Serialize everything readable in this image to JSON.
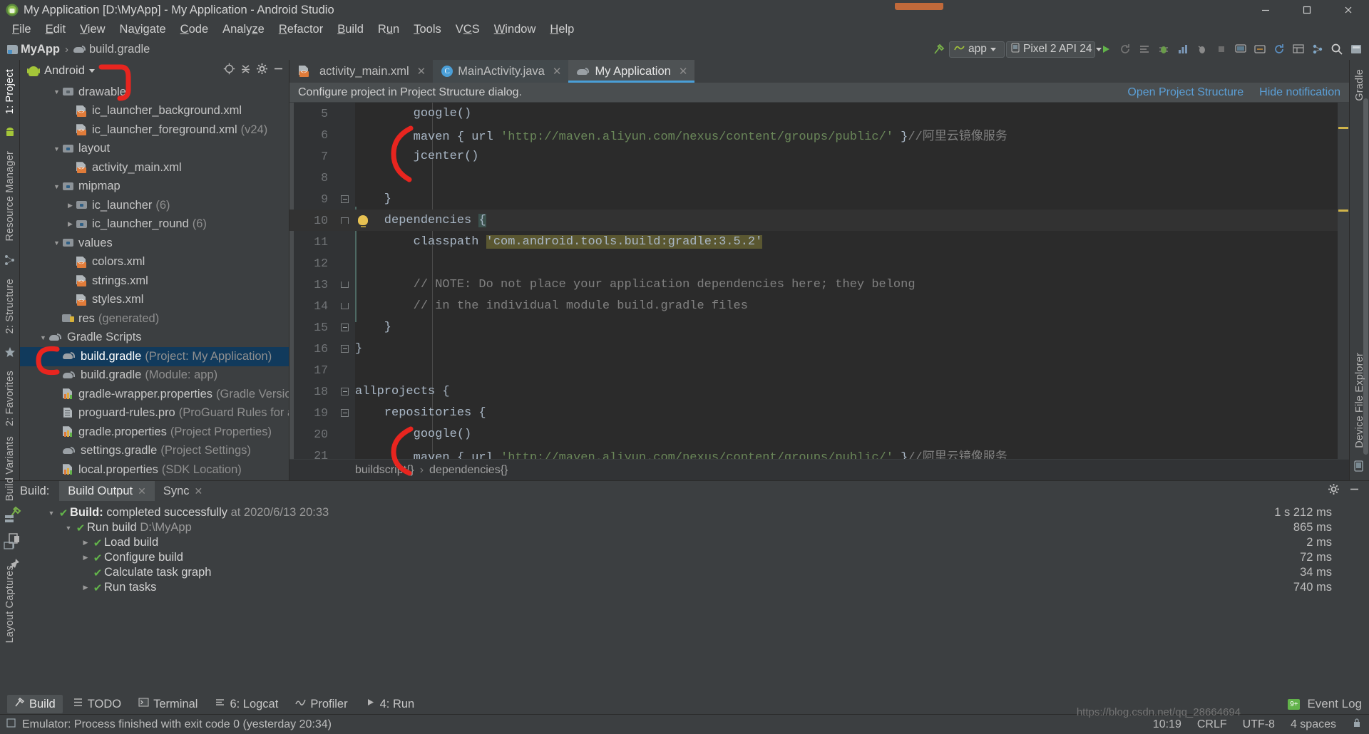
{
  "window": {
    "title": "My Application [D:\\MyApp] - My Application - Android Studio",
    "app_icon": "android-studio-icon",
    "minimize": "–",
    "maximize": "▢",
    "close": "✕"
  },
  "menubar": {
    "items": [
      {
        "label": "File"
      },
      {
        "label": "Edit"
      },
      {
        "label": "View"
      },
      {
        "label": "Navigate"
      },
      {
        "label": "Code"
      },
      {
        "label": "Analyze"
      },
      {
        "label": "Refactor"
      },
      {
        "label": "Build"
      },
      {
        "label": "Run"
      },
      {
        "label": "Tools"
      },
      {
        "label": "VCS"
      },
      {
        "label": "Window"
      },
      {
        "label": "Help"
      }
    ]
  },
  "toolbar": {
    "breadcrumb": {
      "project": "MyApp",
      "separator": "›",
      "file": "build.gradle"
    },
    "module_selector": "app",
    "device_selector": "Pixel 2 API 24",
    "run_icon": "run-play-icon",
    "rerun_icon": "rerun-icon",
    "apply_changes_icon": "apply-changes-icon",
    "debug_icon": "debug-icon",
    "profile_icon": "profile-icon",
    "attach_icon": "attach-debugger-icon",
    "stop_icon": "stop-icon",
    "avd_icon": "avd-manager-icon",
    "sdk_icon": "sdk-manager-icon",
    "sync_icon": "gradle-sync-icon",
    "search_icon": "search-everywhere-icon",
    "layout_icon": "layout-inspector-icon",
    "hammer_icon": "make-project-icon",
    "project_structure_icon": "project-structure-icon"
  },
  "left_rail": {
    "tabs": [
      {
        "label": "1: Project",
        "active": true
      },
      {
        "label": "Resource Manager",
        "active": false
      },
      {
        "label": "2: Structure",
        "active": false
      },
      {
        "label": "2: Favorites",
        "active": false
      }
    ]
  },
  "right_rail": {
    "tabs": [
      {
        "label": "Gradle"
      },
      {
        "label": "Device File Explorer"
      }
    ]
  },
  "bottom_left_rail": {
    "tabs": [
      {
        "label": "Build Variants"
      },
      {
        "label": "Layout Captures"
      }
    ]
  },
  "project_panel": {
    "title": "Android",
    "dropdown_caret": "▾",
    "locate_icon": "locate-file-icon",
    "collapse_icon": "collapse-all-icon",
    "settings_icon": "gear-icon",
    "hide_icon": "hide-panel-icon",
    "tree": [
      {
        "indent": 2,
        "arrow": "▼",
        "icon": "folder-drawable",
        "label": "drawable",
        "sub": ""
      },
      {
        "indent": 3,
        "arrow": "",
        "icon": "xml-file",
        "label": "ic_launcher_background.xml",
        "sub": ""
      },
      {
        "indent": 3,
        "arrow": "",
        "icon": "xml-file",
        "label": "ic_launcher_foreground.xml",
        "sub": "(v24)"
      },
      {
        "indent": 2,
        "arrow": "▼",
        "icon": "folder-blue",
        "label": "layout",
        "sub": ""
      },
      {
        "indent": 3,
        "arrow": "",
        "icon": "xml-file",
        "label": "activity_main.xml",
        "sub": ""
      },
      {
        "indent": 2,
        "arrow": "▼",
        "icon": "folder-blue",
        "label": "mipmap",
        "sub": ""
      },
      {
        "indent": 3,
        "arrow": "▶",
        "icon": "folder-blue",
        "label": "ic_launcher",
        "sub": "(6)"
      },
      {
        "indent": 3,
        "arrow": "▶",
        "icon": "folder-blue",
        "label": "ic_launcher_round",
        "sub": "(6)"
      },
      {
        "indent": 2,
        "arrow": "▼",
        "icon": "folder-blue",
        "label": "values",
        "sub": ""
      },
      {
        "indent": 3,
        "arrow": "",
        "icon": "xml-file",
        "label": "colors.xml",
        "sub": ""
      },
      {
        "indent": 3,
        "arrow": "",
        "icon": "xml-file",
        "label": "strings.xml",
        "sub": ""
      },
      {
        "indent": 3,
        "arrow": "",
        "icon": "xml-file",
        "label": "styles.xml",
        "sub": ""
      },
      {
        "indent": 2,
        "arrow": "",
        "icon": "res-generated",
        "label": "res",
        "sub": "(generated)"
      },
      {
        "indent": 1,
        "arrow": "▼",
        "icon": "gradle",
        "label": "Gradle Scripts",
        "sub": ""
      },
      {
        "indent": 2,
        "arrow": "",
        "icon": "gradle",
        "label": "build.gradle",
        "sub": "(Project: My Application)",
        "selected": true
      },
      {
        "indent": 2,
        "arrow": "",
        "icon": "gradle",
        "label": "build.gradle",
        "sub": "(Module: app)"
      },
      {
        "indent": 2,
        "arrow": "",
        "icon": "properties",
        "label": "gradle-wrapper.properties",
        "sub": "(Gradle Version)"
      },
      {
        "indent": 2,
        "arrow": "",
        "icon": "text-file",
        "label": "proguard-rules.pro",
        "sub": "(ProGuard Rules for ap"
      },
      {
        "indent": 2,
        "arrow": "",
        "icon": "properties",
        "label": "gradle.properties",
        "sub": "(Project Properties)"
      },
      {
        "indent": 2,
        "arrow": "",
        "icon": "gradle",
        "label": "settings.gradle",
        "sub": "(Project Settings)"
      },
      {
        "indent": 2,
        "arrow": "",
        "icon": "properties",
        "label": "local.properties",
        "sub": "(SDK Location)"
      }
    ]
  },
  "editor": {
    "tabs": [
      {
        "label": "activity_main.xml",
        "icon": "xml-file-icon",
        "active": false,
        "close": "✕"
      },
      {
        "label": "MainActivity.java",
        "icon": "java-class-icon",
        "active": false,
        "close": "✕"
      },
      {
        "label": "My Application",
        "icon": "gradle-icon",
        "active": true,
        "close": "✕"
      }
    ],
    "notification": {
      "message": "Configure project in Project Structure dialog.",
      "action_primary": "Open Project Structure",
      "action_secondary": "Hide notification"
    },
    "lines": [
      {
        "n": "5",
        "text": "        google()",
        "type": "plain"
      },
      {
        "n": "6",
        "text": "        maven { url 'http://maven.aliyun.com/nexus/content/groups/public/' }//阿里云镜像服务",
        "type": "maven"
      },
      {
        "n": "7",
        "text": "        jcenter()",
        "type": "plain"
      },
      {
        "n": "8",
        "text": "",
        "type": "plain"
      },
      {
        "n": "9",
        "text": "    }",
        "type": "plain"
      },
      {
        "n": "10",
        "text": "    dependencies {",
        "type": "deps"
      },
      {
        "n": "11",
        "text": "        classpath 'com.android.tools.build:gradle:3.5.2'",
        "type": "classpath"
      },
      {
        "n": "12",
        "text": "",
        "type": "plain"
      },
      {
        "n": "13",
        "text": "        // NOTE: Do not place your application dependencies here; they belong",
        "type": "comment"
      },
      {
        "n": "14",
        "text": "        // in the individual module build.gradle files",
        "type": "comment"
      },
      {
        "n": "15",
        "text": "    }",
        "type": "plain"
      },
      {
        "n": "16",
        "text": "}",
        "type": "plain"
      },
      {
        "n": "17",
        "text": "",
        "type": "plain"
      },
      {
        "n": "18",
        "text": "allprojects {",
        "type": "plain"
      },
      {
        "n": "19",
        "text": "    repositories {",
        "type": "plain"
      },
      {
        "n": "20",
        "text": "        google()",
        "type": "plain"
      },
      {
        "n": "21",
        "text": "        maven { url 'http://maven.aliyun.com/nexus/content/groups/public/' }//阿里云镜像服务",
        "type": "maven"
      }
    ],
    "code_parts": {
      "maven_prefix": "        maven { url ",
      "maven_url": "'http://maven.aliyun.com/nexus/content/groups/public/'",
      "maven_suffix": " }",
      "maven_comment": "//阿里云镜像服务",
      "deps_word": "    dependencies ",
      "deps_brace": "{",
      "classpath_word": "        classpath ",
      "classpath_str": "'com.android.tools.build:gradle:3.5.2'"
    },
    "breadcrumb_bar": {
      "first": "buildscript{}",
      "sep": "›",
      "second": "dependencies{}"
    }
  },
  "build_panel": {
    "label": "Build:",
    "tabs": [
      {
        "label": "Build Output",
        "active": true,
        "close": "✕"
      },
      {
        "label": "Sync",
        "active": false,
        "close": "✕"
      }
    ],
    "settings_icon": "gear-icon",
    "hide_icon": "hide-panel-icon",
    "tool_icons": [
      "restart-build-icon",
      "toggle-view-icon",
      "pin-tab-icon"
    ],
    "rows": [
      {
        "indent": 0,
        "arrow": "▼",
        "status": "✔",
        "bold": "Build:",
        "text": " completed successfully",
        "dim": " at 2020/6/13 20:33",
        "time": "1 s 212 ms"
      },
      {
        "indent": 1,
        "arrow": "▼",
        "status": "✔",
        "bold": "",
        "text": "Run build ",
        "dim": "D:\\MyApp",
        "time": "865 ms"
      },
      {
        "indent": 2,
        "arrow": "▶",
        "status": "✔",
        "bold": "",
        "text": "Load build",
        "dim": "",
        "time": "2 ms"
      },
      {
        "indent": 2,
        "arrow": "▶",
        "status": "✔",
        "bold": "",
        "text": "Configure build",
        "dim": "",
        "time": "72 ms"
      },
      {
        "indent": 2,
        "arrow": "",
        "status": "✔",
        "bold": "",
        "text": "Calculate task graph",
        "dim": "",
        "time": "34 ms"
      },
      {
        "indent": 2,
        "arrow": "▶",
        "status": "✔",
        "bold": "",
        "text": "Run tasks",
        "dim": "",
        "time": "740 ms"
      }
    ]
  },
  "bottom_bar": {
    "items": [
      {
        "label": "Build",
        "icon": "hammer-icon",
        "active": true
      },
      {
        "label": "TODO",
        "icon": "todo-icon",
        "active": false
      },
      {
        "label": "Terminal",
        "icon": "terminal-icon",
        "active": false
      },
      {
        "label": "6: Logcat",
        "icon": "logcat-icon",
        "active": false
      },
      {
        "label": "Profiler",
        "icon": "profiler-icon",
        "active": false
      },
      {
        "label": "4: Run",
        "icon": "run-icon",
        "active": false
      }
    ],
    "event_log": {
      "label": "Event Log",
      "badge": "9+"
    }
  },
  "status_bar": {
    "message": "Emulator: Process finished with exit code 0 (yesterday 20:34)",
    "caret_icon": "caret-position-icon",
    "time": "10:19",
    "line_sep": "CRLF",
    "encoding": "UTF-8",
    "indent": "4 spaces",
    "lock_icon": "lock-icon"
  },
  "watermark": "https://blog.csdn.net/qq_28664694",
  "colors": {
    "accent_blue": "#4a9fd8",
    "selection_blue": "#113a5c",
    "success_green": "#62b34a",
    "annotation_red": "#e8251f",
    "panel_bg": "#3c3f41",
    "editor_bg": "#2b2b2b",
    "gutter_bg": "#313335",
    "string_green": "#6a8759",
    "keyword_orange": "#cc7832"
  }
}
